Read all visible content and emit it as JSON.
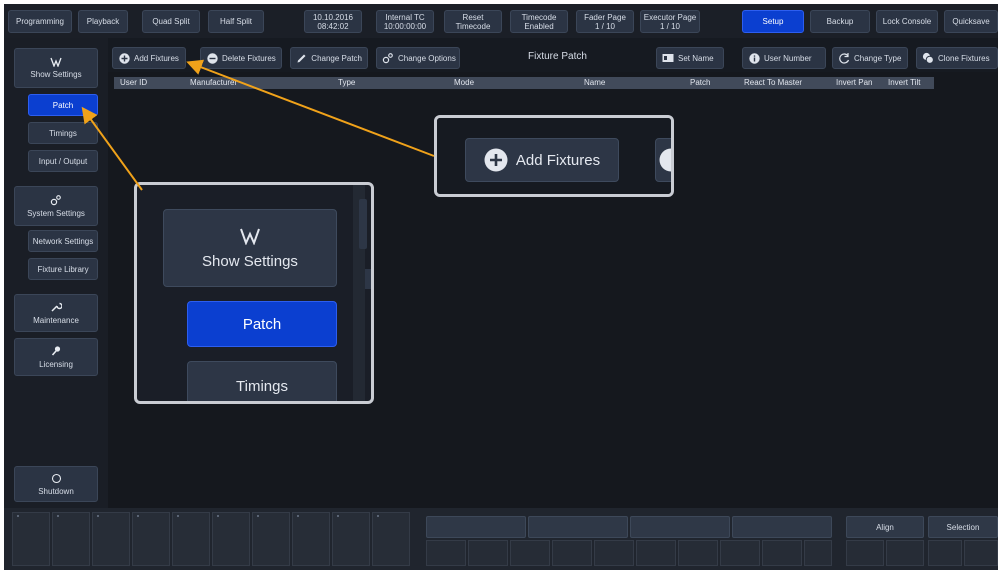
{
  "topbar": {
    "programming": "Programming",
    "playback": "Playback",
    "quad_split": "Quad Split",
    "half_split": "Half Split",
    "date": "10.10.2016",
    "time": "08:42:02",
    "tc_label": "Internal TC",
    "tc_value": "10:00:00:00",
    "reset_1": "Reset",
    "reset_2": "Timecode",
    "timecode_1": "Timecode",
    "timecode_2": "Enabled",
    "fader_page_label": "Fader Page",
    "fader_page_value": "1 / 10",
    "executor_page_label": "Executor Page",
    "executor_page_value": "1 / 10",
    "setup": "Setup",
    "backup": "Backup",
    "lock_console": "Lock Console",
    "quicksave": "Quicksave"
  },
  "sidebar": {
    "show_settings": "Show Settings",
    "patch": "Patch",
    "timings": "Timings",
    "input_output": "Input / Output",
    "system_settings": "System Settings",
    "network_settings": "Network Settings",
    "fixture_library": "Fixture Library",
    "maintenance": "Maintenance",
    "licensing": "Licensing",
    "shutdown": "Shutdown"
  },
  "toolbar": {
    "add_fixtures": "Add Fixtures",
    "delete_fixtures": "Delete Fixtures",
    "change_patch": "Change Patch",
    "change_options": "Change Options",
    "title": "Fixture Patch",
    "set_name": "Set Name",
    "user_number": "User Number",
    "change_type": "Change Type",
    "clone_fixtures": "Clone Fixtures"
  },
  "table": {
    "columns": [
      "User ID",
      "Manufacturer",
      "Type",
      "Mode",
      "Name",
      "Patch",
      "React To Master",
      "Invert Pan",
      "Invert Tilt"
    ]
  },
  "bottom": {
    "align": "Align",
    "selection": "Selection"
  },
  "zoom_toolbar": {
    "add_fixtures": "Add Fixtures"
  },
  "zoom_sidebar": {
    "show_settings": "Show Settings",
    "patch": "Patch",
    "timings": "Timings"
  },
  "colors": {
    "accent_blue": "#0b3fd0",
    "arrow_orange": "#f0a21a",
    "background": "#15181e",
    "button": "#2b3444"
  }
}
